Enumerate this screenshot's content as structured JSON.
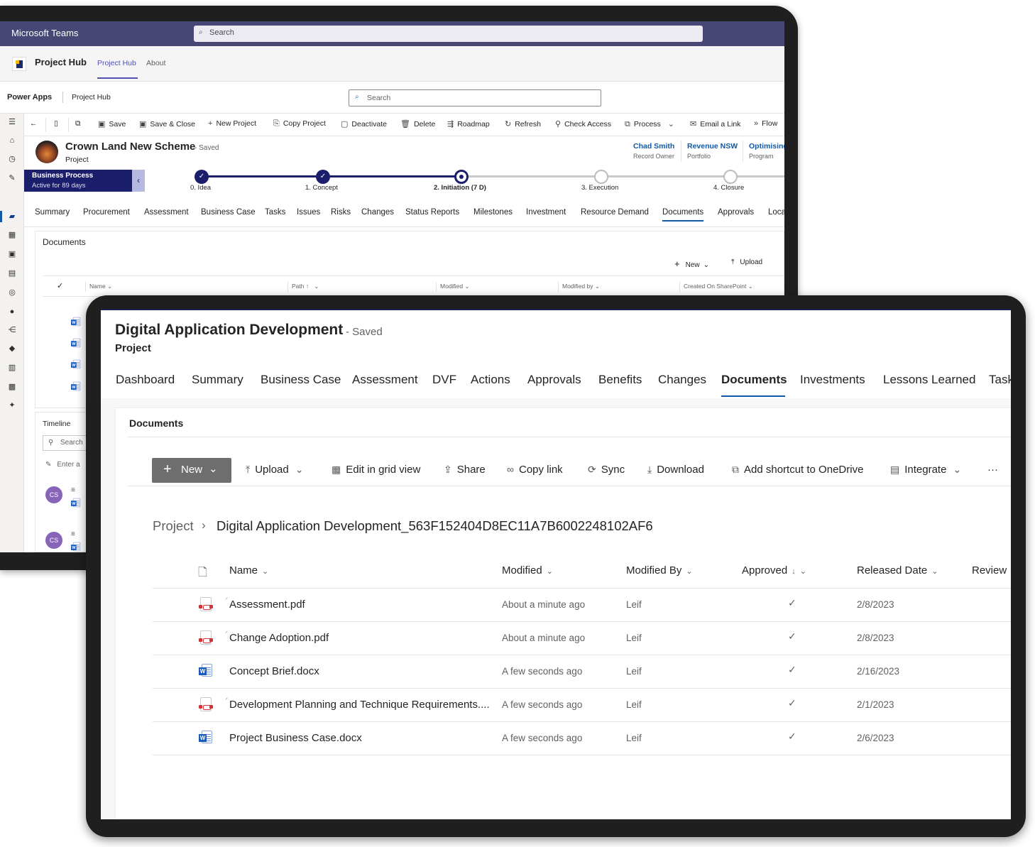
{
  "back_window": {
    "teams_title": "Microsoft Teams",
    "teams_search": "Search",
    "project_hub": {
      "name": "Project Hub",
      "tabs": [
        "Project Hub",
        "About"
      ]
    },
    "power_apps": {
      "name": "Power Apps",
      "app": "Project Hub",
      "search": "Search"
    },
    "commands": [
      "Save",
      "Save & Close",
      "New Project",
      "Copy Project",
      "Deactivate",
      "Delete",
      "Roadmap",
      "Refresh",
      "Check Access",
      "Process",
      "Email a Link",
      "Flow"
    ],
    "record": {
      "title": "Crown Land New Scheme",
      "saved": "- Saved",
      "entity": "Project",
      "fields": [
        {
          "value": "Chad Smith",
          "label": "Record Owner"
        },
        {
          "value": "Revenue NSW",
          "label": "Portfolio"
        },
        {
          "value": "Optimising",
          "label": "Program"
        }
      ]
    },
    "bpf": {
      "title": "Business Process",
      "subtitle": "Active for 89 days",
      "stages": [
        "0. Idea",
        "1. Concept",
        "2. Initiation  (7 D)",
        "3. Execution",
        "4. Closure"
      ]
    },
    "tabs": [
      "Summary",
      "Procurement",
      "Assessment",
      "Business Case",
      "Tasks",
      "Issues",
      "Risks",
      "Changes",
      "Status Reports",
      "Milestones",
      "Investment",
      "Resource Demand",
      "Documents",
      "Approvals",
      "Loca"
    ],
    "selected_tab": "Documents",
    "documents": {
      "title": "Documents",
      "new_label": "New",
      "upload_label": "Upload",
      "columns": [
        "Name",
        "Path",
        "Modified",
        "Modified by",
        "Created On SharePoint"
      ]
    },
    "timeline": {
      "title": "Timeline",
      "search": "Search",
      "enter": "Enter a",
      "avatar_initials": "CS"
    }
  },
  "front_window": {
    "title": "Digital Application Development",
    "saved": "- Saved",
    "entity": "Project",
    "tabs": [
      "Dashboard",
      "Summary",
      "Business Case",
      "Assessment",
      "DVF",
      "Actions",
      "Approvals",
      "Benefits",
      "Changes",
      "Documents",
      "Investments",
      "Lessons Learned",
      "Task"
    ],
    "selected_tab": "Documents",
    "card_title": "Documents",
    "commands": {
      "new": "New",
      "upload": "Upload",
      "edit_grid": "Edit in grid view",
      "share": "Share",
      "copy_link": "Copy link",
      "sync": "Sync",
      "download": "Download",
      "shortcut": "Add shortcut to OneDrive",
      "integrate": "Integrate",
      "more": "···"
    },
    "breadcrumb": {
      "root": "Project",
      "folder": "Digital Application Development_563F152404D8EC11A7B6002248102AF6"
    },
    "columns": [
      "Name",
      "Modified",
      "Modified By",
      "Approved",
      "Released Date",
      "Review"
    ],
    "rows": [
      {
        "type": "pdf",
        "name": "Assessment.pdf",
        "modified": "About a minute ago",
        "modified_by": "Leif",
        "approved": true,
        "released": "2/8/2023"
      },
      {
        "type": "pdf",
        "name": "Change Adoption.pdf",
        "modified": "About a minute ago",
        "modified_by": "Leif",
        "approved": true,
        "released": "2/8/2023"
      },
      {
        "type": "word",
        "name": "Concept Brief.docx",
        "modified": "A few seconds ago",
        "modified_by": "Leif",
        "approved": true,
        "released": "2/16/2023"
      },
      {
        "type": "pdf",
        "name": "Development Planning and Technique Requirements....",
        "modified": "A few seconds ago",
        "modified_by": "Leif",
        "approved": true,
        "released": "2/1/2023"
      },
      {
        "type": "word",
        "name": "Project Business Case.docx",
        "modified": "A few seconds ago",
        "modified_by": "Leif",
        "approved": true,
        "released": "2/6/2023"
      }
    ]
  },
  "colors": {
    "teams_bar": "#464775",
    "bpf_dark": "#1b1f6b",
    "link_blue": "#1159a4",
    "word_blue": "#185abd",
    "pdf_red": "#d13438",
    "new_button": "#6e6e6e"
  }
}
